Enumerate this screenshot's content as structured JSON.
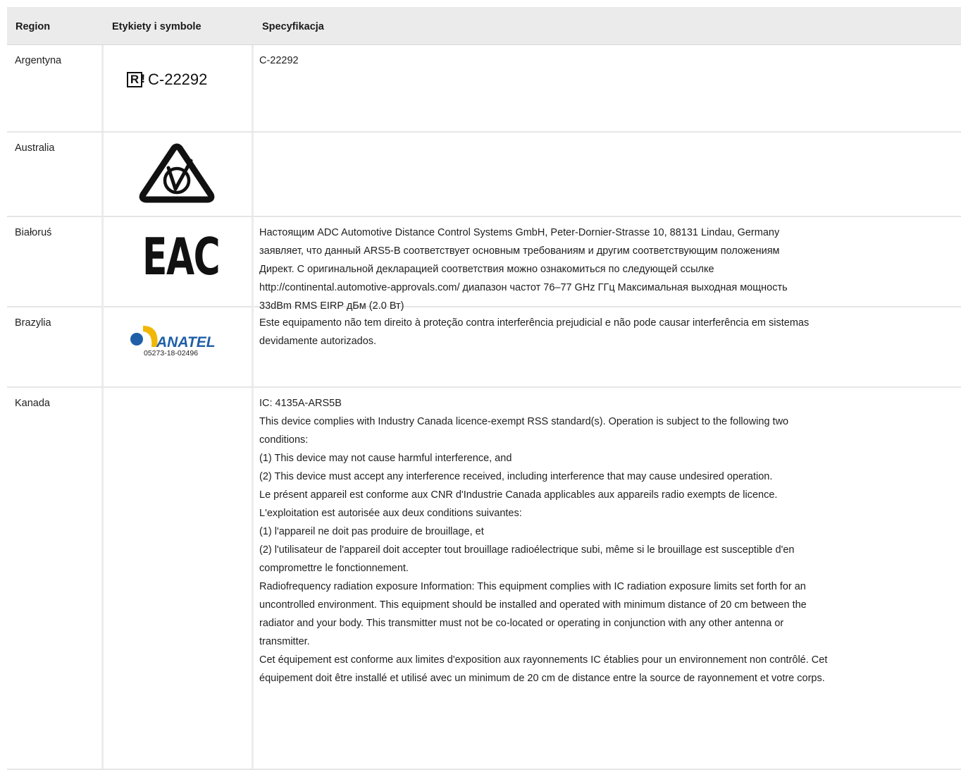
{
  "headers": {
    "region": "Region",
    "symbols": "Etykiety i symbole",
    "spec": "Specyfikacja"
  },
  "rows": {
    "argentina": {
      "region": "Argentyna",
      "symbol_mark": "R",
      "symbol_mark_suffix": "!",
      "symbol_code": "C-22292",
      "spec": [
        "C-22292"
      ]
    },
    "australia": {
      "region": "Australia",
      "symbol_icon": "rcm-compliance-icon",
      "spec": []
    },
    "belarus": {
      "region": "Białoruś",
      "symbol_text": "EAC",
      "spec": [
        "Настоящим ADC Automotive Distance Control Systems GmbH, Peter-Dornier-Strasse 10, 88131 Lindau, Germany",
        "заявляет, что данный ARS5-B соответствует основным требованиям и другим соответствующим положениям",
        "Директ. С оригинальной декларацией соответствия можно ознакомиться по следующей ссылке",
        "http://continental.automotive-approvals.com/ диапазон частот 76–77 GHz ГГц Максимальная выходная мощность",
        "33dBm RMS EIRP дБм (2.0 Вт)"
      ]
    },
    "brazil": {
      "region": "Brazylia",
      "symbol_logo_text": "ANATEL",
      "symbol_code": "05273-18-02496",
      "brand_blue": "#1f5fa8",
      "brand_yellow": "#f2b705",
      "spec": [
        "Este equipamento não tem direito à proteção contra interferência prejudicial e não pode causar interferência em sistemas",
        "devidamente autorizados."
      ]
    },
    "canada": {
      "region": "Kanada",
      "spec": [
        "IC: 4135A-ARS5B",
        "This device complies with Industry Canada licence-exempt RSS standard(s). Operation is subject to the following two",
        "conditions:",
        "(1) This device may not cause harmful interference, and",
        "(2) This device must accept any interference received, including interference that may cause undesired operation.",
        "Le présent appareil est conforme aux CNR d'Industrie Canada applicables aux appareils radio exempts de licence.",
        "L'exploitation est autorisée aux deux conditions suivantes:",
        "(1) l'appareil ne doit pas produire de brouillage, et",
        "(2) l'utilisateur de l'appareil doit accepter tout brouillage radioélectrique subi, même si le brouillage est susceptible d'en",
        "compromettre le fonctionnement.",
        "Radiofrequency radiation exposure Information: This equipment complies with IC radiation exposure limits set forth for an",
        "uncontrolled environment. This equipment should be installed and operated with minimum distance of 20 cm between the",
        "radiator and your body. This transmitter must not be co-located or operating in conjunction with any other antenna or",
        "transmitter.",
        "Cet équipement est conforme aux limites d'exposition aux rayonnements IC établies pour un environnement non contrôlé. Cet",
        "équipement doit être installé et utilisé avec un minimum de 20 cm de distance entre la source de rayonnement et votre corps."
      ]
    }
  }
}
